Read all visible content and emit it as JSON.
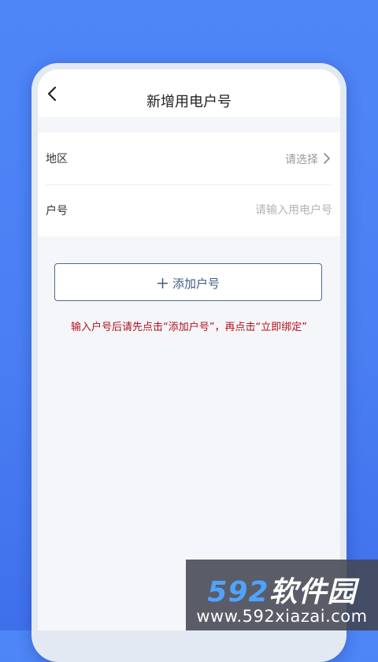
{
  "header": {
    "title": "新增用电户号",
    "back_icon": "chevron-left-icon"
  },
  "form": {
    "region": {
      "label": "地区",
      "value": "请选择",
      "icon": "chevron-right-icon"
    },
    "account": {
      "label": "户号",
      "value": "",
      "placeholder": "请输入用电户号"
    }
  },
  "actions": {
    "add_label": "添加户号",
    "add_icon": "plus-icon"
  },
  "hint": "输入户号后请先点击“添加户号”，再点击“立即绑定”",
  "watermark": {
    "brand_digits": "592",
    "brand_text": "软件园",
    "url": "www.592xiazai.com"
  },
  "colors": {
    "background": "#4a7ff3",
    "button_border": "#4f6a8c",
    "button_text": "#3f5b80",
    "hint_text": "#b4111b",
    "placeholder": "#b3b3b3"
  }
}
